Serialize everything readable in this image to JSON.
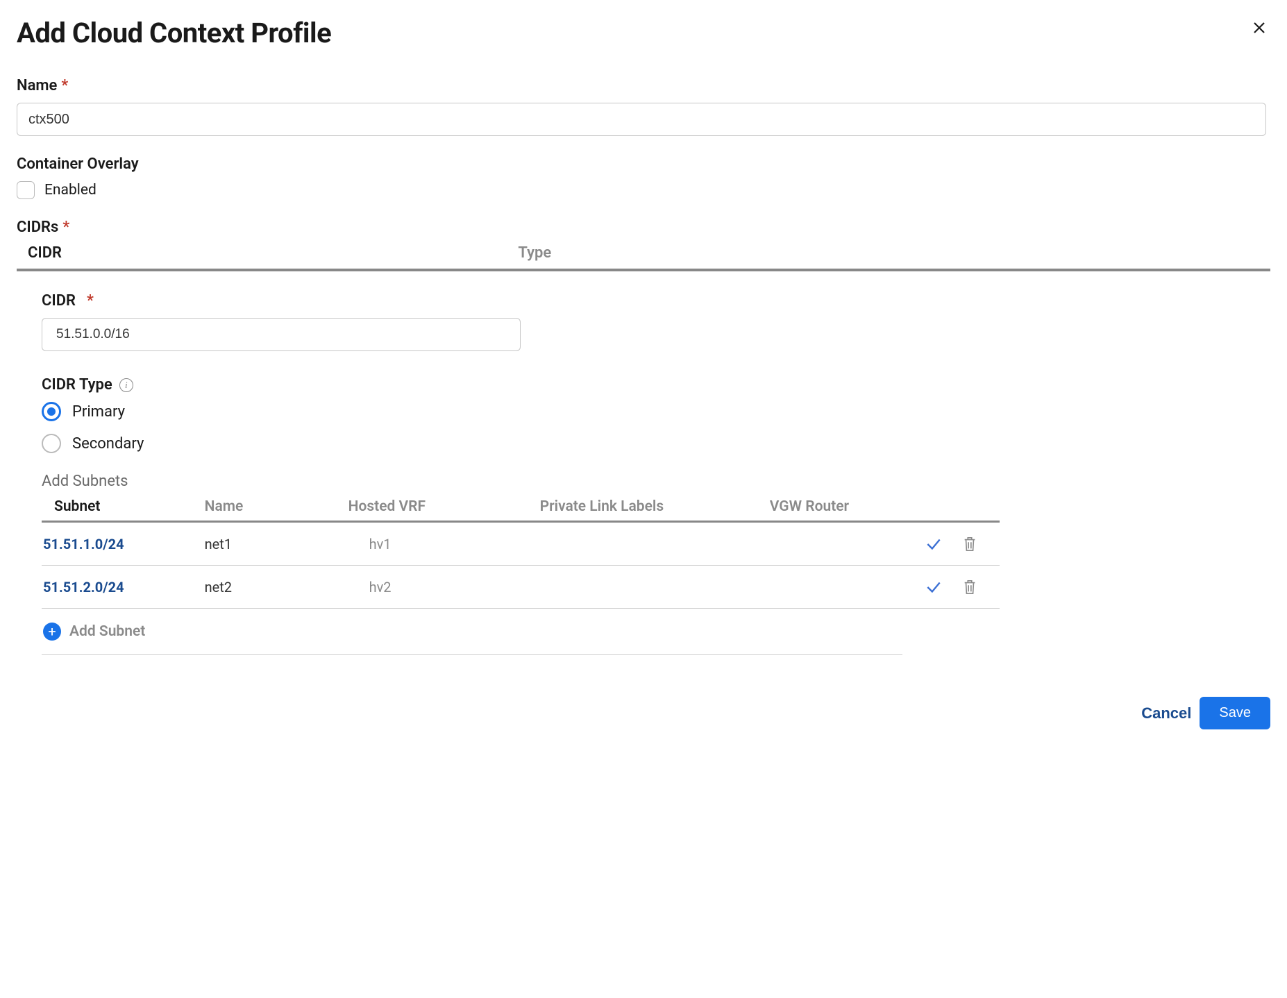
{
  "modal": {
    "title": "Add Cloud Context Profile"
  },
  "form": {
    "name_label": "Name",
    "name_value": "ctx500",
    "container_overlay_label": "Container Overlay",
    "container_overlay_enabled_label": "Enabled",
    "cidrs_label": "CIDRs",
    "cidrs_table": {
      "col_cidr": "CIDR",
      "col_type": "Type"
    },
    "cidr_detail": {
      "cidr_label": "CIDR",
      "cidr_value": "51.51.0.0/16",
      "cidr_type_label": "CIDR Type",
      "radio_primary": "Primary",
      "radio_secondary": "Secondary",
      "selected": "primary"
    },
    "subnets": {
      "title": "Add Subnets",
      "headers": {
        "subnet": "Subnet",
        "name": "Name",
        "hosted_vrf": "Hosted VRF",
        "pll": "Private Link Labels",
        "vgw": "VGW Router"
      },
      "rows": [
        {
          "subnet": "51.51.1.0/24",
          "name": "net1",
          "hosted_vrf": "hv1",
          "pll": "",
          "vgw": ""
        },
        {
          "subnet": "51.51.2.0/24",
          "name": "net2",
          "hosted_vrf": "hv2",
          "pll": "",
          "vgw": ""
        }
      ],
      "add_label": "Add Subnet"
    }
  },
  "footer": {
    "cancel": "Cancel",
    "save": "Save"
  }
}
